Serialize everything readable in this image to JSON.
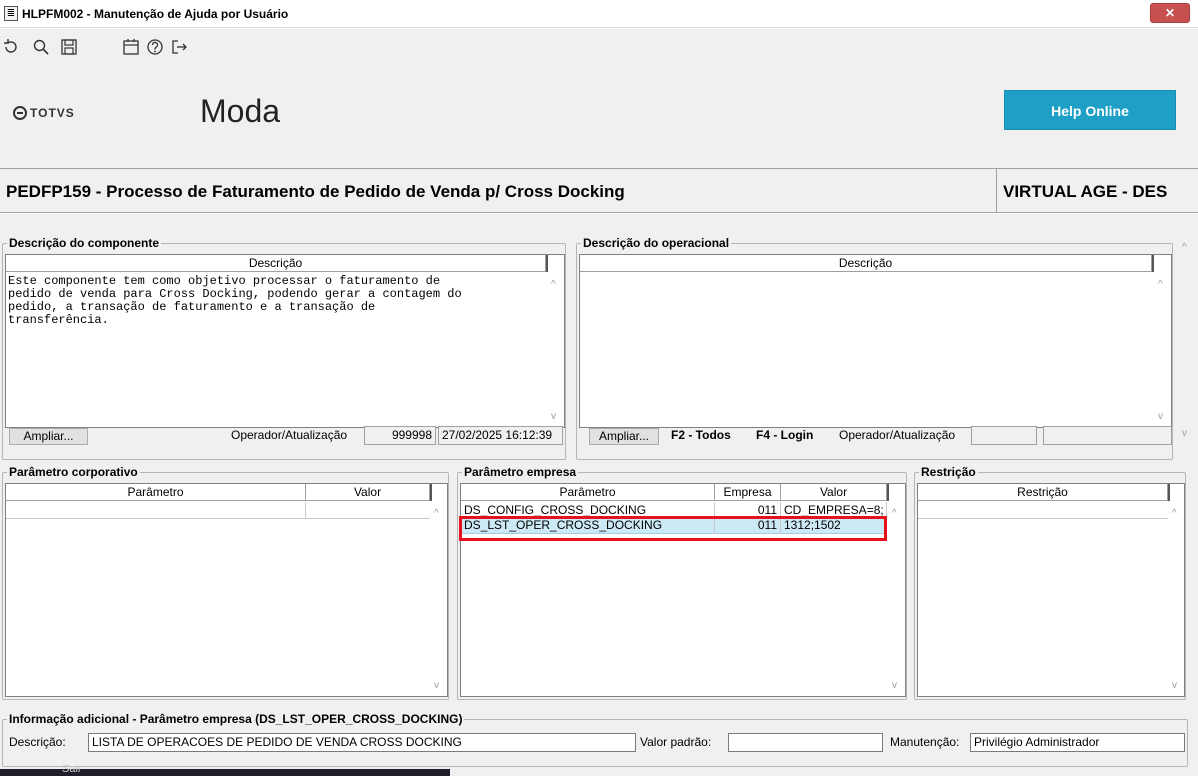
{
  "window": {
    "title": "HLPFM002 - Manutenção de Ajuda por Usuário",
    "close_glyph": "✕",
    "app_icon_glyph": "≣"
  },
  "toolbar": {
    "icons": [
      "refresh-icon",
      "search-icon",
      "save-icon",
      "calendar-icon",
      "help-icon",
      "exit-icon"
    ]
  },
  "header": {
    "logo_text": "TOTVS",
    "module_name": "Moda",
    "help_button": "Help Online"
  },
  "program": {
    "title": "PEDFP159 - Processo de Faturamento de Pedido de Venda p/ Cross Docking",
    "environment": "VIRTUAL AGE - DES"
  },
  "component_desc": {
    "label": "Descrição do componente",
    "column": "Descrição",
    "text": "Este componente tem como objetivo processar o faturamento de\npedido de venda para Cross Docking, podendo gerar a contagem do\npedido, a transação de faturamento e a transação de\ntransferência.",
    "expand_button": "Ampliar...",
    "operator_label": "Operador/Atualização",
    "operator_value": "999998",
    "updated_value": "27/02/2025 16:12:39"
  },
  "operational_desc": {
    "label": "Descrição do operacional",
    "column": "Descrição",
    "text": "",
    "expand_button": "Ampliar...",
    "f2_label": "F2 - Todos",
    "f4_label": "F4 - Login",
    "operator_label": "Operador/Atualização",
    "operator_value": "",
    "updated_value": ""
  },
  "corporate_params": {
    "label": "Parâmetro corporativo",
    "columns": [
      "Parâmetro",
      "Valor"
    ],
    "rows": []
  },
  "company_params": {
    "label": "Parâmetro empresa",
    "columns": [
      "Parâmetro",
      "Empresa",
      "Valor"
    ],
    "rows": [
      {
        "param": "DS_CONFIG_CROSS_DOCKING",
        "company": "011",
        "value": "CD_EMPRESA=8;"
      },
      {
        "param": "DS_LST_OPER_CROSS_DOCKING",
        "company": "011",
        "value": "1312;1502"
      }
    ],
    "selected_index": 1
  },
  "restriction": {
    "label": "Restrição",
    "columns": [
      "Restrição"
    ],
    "rows": []
  },
  "additional_info": {
    "label": "Informação adicional - Parâmetro empresa (DS_LST_OPER_CROSS_DOCKING)",
    "desc_label": "Descrição:",
    "desc_value": "LISTA DE OPERACOES DE PEDIDO DE VENDA CROSS DOCKING",
    "default_label": "Valor padrão:",
    "default_value": "",
    "maint_label": "Manutenção:",
    "maint_value": "Privilégio Administrador"
  },
  "taskbar": {
    "label": "Sair"
  },
  "colors": {
    "accent": "#1e9fc6",
    "highlight": "#e8101c",
    "selected_row": "#cceaf5"
  }
}
